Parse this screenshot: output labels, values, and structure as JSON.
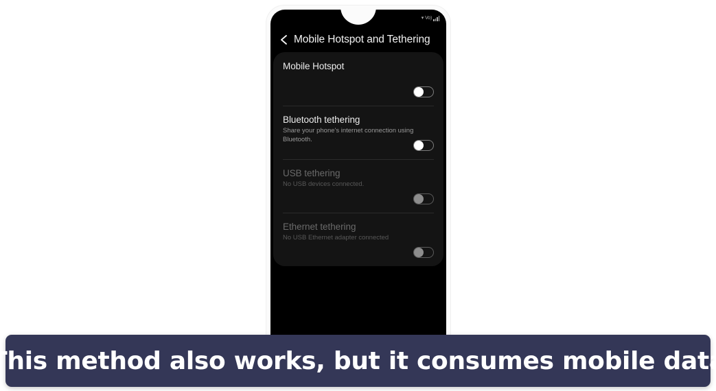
{
  "phone": {
    "status_bar": {
      "wifi_icon": "wifi-icon",
      "signal_icon": "signal-bars-icon",
      "network_label": "Vo)"
    },
    "header": {
      "back_icon": "back-chevron-icon",
      "title": "Mobile Hotspot and Tethering"
    },
    "settings": [
      {
        "title": "Mobile Hotspot",
        "subtitle": "",
        "toggle_state": "off",
        "enabled": true,
        "name": "mobile-hotspot"
      },
      {
        "title": "Bluetooth tethering",
        "subtitle": "Share your phone's internet connection using Bluetooth.",
        "toggle_state": "off",
        "enabled": true,
        "name": "bluetooth-tethering"
      },
      {
        "title": "USB tethering",
        "subtitle": "No USB devices connected.",
        "toggle_state": "off",
        "enabled": false,
        "name": "usb-tethering"
      },
      {
        "title": "Ethernet tethering",
        "subtitle": "No USB Ethernet adapter connected",
        "toggle_state": "off",
        "enabled": false,
        "name": "ethernet-tethering"
      }
    ]
  },
  "caption": {
    "text": "This method also works, but it consumes mobile data",
    "background_color": "#343757",
    "text_color": "#ffffff"
  }
}
